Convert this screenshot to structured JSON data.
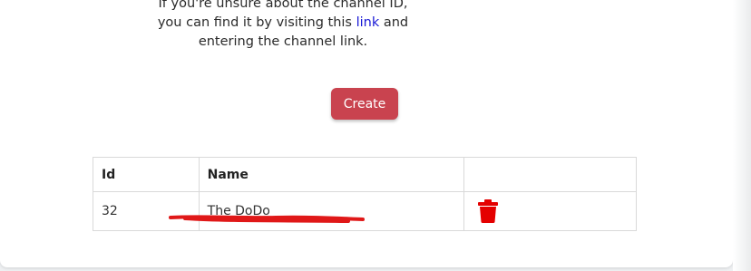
{
  "help": {
    "line1": "If you're unsure about the channel ID,",
    "line2_prefix": "you can find it by visiting this ",
    "link_label": "link",
    "line2_suffix": " and",
    "line3": "entering the channel link."
  },
  "create_button": {
    "label": "Create"
  },
  "table": {
    "headers": [
      "Id",
      "Name",
      ""
    ],
    "rows": [
      {
        "id": "32",
        "name": "The DoDo"
      }
    ]
  },
  "colors": {
    "accent_button": "#c9434f",
    "link": "#1a1ad6",
    "delete_icon": "#e40000",
    "annotation": "#e01818"
  },
  "icons": {
    "delete": "trash-icon"
  }
}
